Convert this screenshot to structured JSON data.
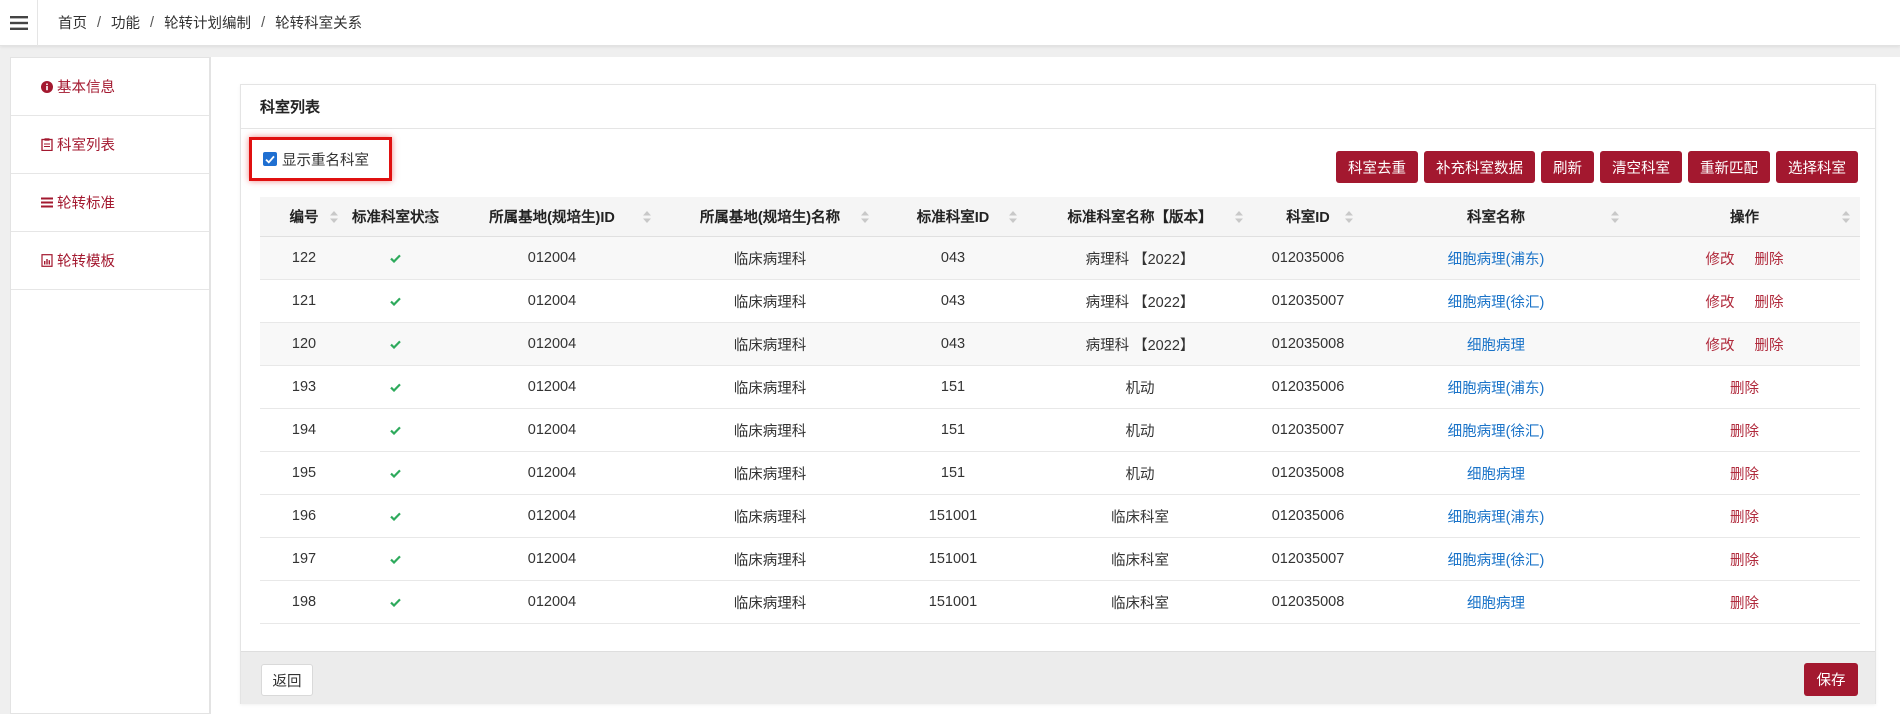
{
  "breadcrumb": [
    "首页",
    "功能",
    "轮转计划编制",
    "轮转科室关系"
  ],
  "sidebar": {
    "items": [
      {
        "label": "基本信息",
        "icon": "info-circle-icon"
      },
      {
        "label": "科室列表",
        "icon": "clipboard-icon"
      },
      {
        "label": "轮转标准",
        "icon": "list-icon"
      },
      {
        "label": "轮转模板",
        "icon": "file-chart-icon"
      }
    ]
  },
  "panel": {
    "title": "科室列表",
    "checkbox_label": "显示重名科室",
    "checkbox_checked": true
  },
  "toolbar": {
    "buttons": [
      "科室去重",
      "补充科室数据",
      "刷新",
      "清空科室",
      "重新匹配",
      "选择科室"
    ]
  },
  "table": {
    "headers": [
      "编号",
      "标准科室状态",
      "所属基地(规培生)ID",
      "所属基地(规培生)名称",
      "标准科室ID",
      "标准科室名称【版本】",
      "科室ID",
      "科室名称",
      "操作"
    ],
    "rows": [
      {
        "id": "122",
        "base_id": "012004",
        "base_name": "临床病理科",
        "std_id": "043",
        "std_name": "病理科 【2022】",
        "dept_id": "012035006",
        "dept_name": "细胞病理(浦东)",
        "edit": "修改",
        "del": "删除"
      },
      {
        "id": "121",
        "base_id": "012004",
        "base_name": "临床病理科",
        "std_id": "043",
        "std_name": "病理科 【2022】",
        "dept_id": "012035007",
        "dept_name": "细胞病理(徐汇)",
        "edit": "修改",
        "del": "删除"
      },
      {
        "id": "120",
        "base_id": "012004",
        "base_name": "临床病理科",
        "std_id": "043",
        "std_name": "病理科 【2022】",
        "dept_id": "012035008",
        "dept_name": "细胞病理",
        "edit": "修改",
        "del": "删除"
      },
      {
        "id": "193",
        "base_id": "012004",
        "base_name": "临床病理科",
        "std_id": "151",
        "std_name": "机动",
        "dept_id": "012035006",
        "dept_name": "细胞病理(浦东)",
        "edit": "",
        "del": "删除"
      },
      {
        "id": "194",
        "base_id": "012004",
        "base_name": "临床病理科",
        "std_id": "151",
        "std_name": "机动",
        "dept_id": "012035007",
        "dept_name": "细胞病理(徐汇)",
        "edit": "",
        "del": "删除"
      },
      {
        "id": "195",
        "base_id": "012004",
        "base_name": "临床病理科",
        "std_id": "151",
        "std_name": "机动",
        "dept_id": "012035008",
        "dept_name": "细胞病理",
        "edit": "",
        "del": "删除"
      },
      {
        "id": "196",
        "base_id": "012004",
        "base_name": "临床病理科",
        "std_id": "151001",
        "std_name": "临床科室",
        "dept_id": "012035006",
        "dept_name": "细胞病理(浦东)",
        "edit": "",
        "del": "删除"
      },
      {
        "id": "197",
        "base_id": "012004",
        "base_name": "临床病理科",
        "std_id": "151001",
        "std_name": "临床科室",
        "dept_id": "012035007",
        "dept_name": "细胞病理(徐汇)",
        "edit": "",
        "del": "删除"
      },
      {
        "id": "198",
        "base_id": "012004",
        "base_name": "临床病理科",
        "std_id": "151001",
        "std_name": "临床科室",
        "dept_id": "012035008",
        "dept_name": "细胞病理",
        "edit": "",
        "del": "删除"
      }
    ]
  },
  "footer": {
    "back_label": "返回",
    "save_label": "保存"
  },
  "colors": {
    "brand": "#a3182f",
    "link": "#1a73c8",
    "check": "#2eaa5c"
  }
}
